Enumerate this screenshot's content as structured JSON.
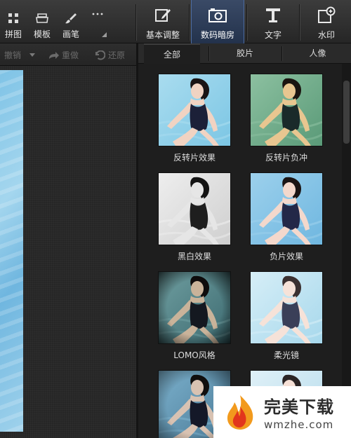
{
  "toolbar": {
    "small_tools": [
      {
        "label": "拼图",
        "icon": "grid-icon"
      },
      {
        "label": "模板",
        "icon": "stack-icon"
      },
      {
        "label": "画笔",
        "icon": "brush-icon"
      },
      {
        "label": "",
        "icon": "more-icon"
      }
    ],
    "big_tools": [
      {
        "label": "基本调整",
        "icon": "edit-icon"
      },
      {
        "label": "数码暗房",
        "icon": "camera-icon",
        "active": true
      },
      {
        "label": "文字",
        "icon": "text-icon"
      },
      {
        "label": "水印",
        "icon": "watermark-icon"
      }
    ]
  },
  "subbar": {
    "undo_label": "撤销",
    "redo_label": "重做",
    "restore_label": "还原"
  },
  "tabs": [
    {
      "label": "全部",
      "active": true
    },
    {
      "label": "胶片"
    },
    {
      "label": "人像"
    }
  ],
  "effects": [
    {
      "label": "反转片效果",
      "style": "reversal"
    },
    {
      "label": "反转片负冲",
      "style": "cross"
    },
    {
      "label": "黑白效果",
      "style": "bw"
    },
    {
      "label": "负片效果",
      "style": "negative"
    },
    {
      "label": "LOMO风格",
      "style": "lomo"
    },
    {
      "label": "柔光镜",
      "style": "soft"
    },
    {
      "label": "",
      "style": "dark"
    },
    {
      "label": "",
      "style": "light"
    }
  ],
  "watermark": {
    "brand": "完美下载",
    "url": "wmzhe.com"
  },
  "colors": {
    "accent": "#4d6da3",
    "panel_bg": "#1e1e1e",
    "logo_orange": "#f29a1d",
    "logo_red": "#e2361c"
  }
}
